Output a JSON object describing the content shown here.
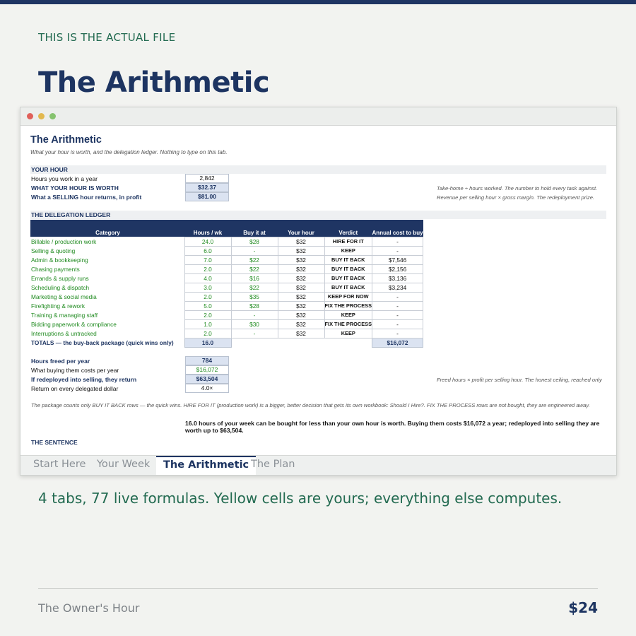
{
  "eyebrow": "THIS IS THE ACTUAL FILE",
  "headline": "The Arithmetic",
  "sheet": {
    "title": "The Arithmetic",
    "subtitle": "What your hour is worth, and the delegation ledger. Nothing to type on this tab.",
    "your_hour": {
      "section": "YOUR HOUR",
      "rows": [
        {
          "label": "Hours you work in a year",
          "value": "2,842",
          "note": ""
        },
        {
          "label": "WHAT YOUR HOUR IS WORTH",
          "value": "$32.37",
          "note": "Take-home ÷ hours worked. The number to hold every task against."
        },
        {
          "label": "What a SELLING hour returns, in profit",
          "value": "$81.00",
          "note": "Revenue per selling hour × gross margin. The redeployment prize."
        }
      ]
    },
    "ledger": {
      "section": "THE DELEGATION LEDGER",
      "headers": [
        "Category",
        "Hours / wk",
        "Buy it at",
        "Your hour",
        "Verdict",
        "Annual cost to buy"
      ],
      "rows": [
        [
          "Billable / production work",
          "24.0",
          "$28",
          "$32",
          "HIRE FOR IT",
          "-"
        ],
        [
          "Selling & quoting",
          "6.0",
          "-",
          "$32",
          "KEEP",
          "-"
        ],
        [
          "Admin & bookkeeping",
          "7.0",
          "$22",
          "$32",
          "BUY IT BACK",
          "$7,546"
        ],
        [
          "Chasing payments",
          "2.0",
          "$22",
          "$32",
          "BUY IT BACK",
          "$2,156"
        ],
        [
          "Errands & supply runs",
          "4.0",
          "$16",
          "$32",
          "BUY IT BACK",
          "$3,136"
        ],
        [
          "Scheduling & dispatch",
          "3.0",
          "$22",
          "$32",
          "BUY IT BACK",
          "$3,234"
        ],
        [
          "Marketing & social media",
          "2.0",
          "$35",
          "$32",
          "KEEP FOR NOW",
          "-"
        ],
        [
          "Firefighting & rework",
          "5.0",
          "$28",
          "$32",
          "FIX THE PROCESS",
          "-"
        ],
        [
          "Training & managing staff",
          "2.0",
          "-",
          "$32",
          "KEEP",
          "-"
        ],
        [
          "Bidding paperwork & compliance",
          "1.0",
          "$30",
          "$32",
          "FIX THE PROCESS",
          "-"
        ],
        [
          "Interruptions & untracked",
          "2.0",
          "-",
          "$32",
          "KEEP",
          "-"
        ]
      ],
      "totals": {
        "label": "TOTALS — the buy-back package (quick wins only)",
        "hours": "16.0",
        "annual": "$16,072"
      }
    },
    "summary": [
      {
        "label": "Hours freed per year",
        "value": "784",
        "note": ""
      },
      {
        "label": "What buying them costs per year",
        "value": "$16,072",
        "note": ""
      },
      {
        "label": "If redeployed into selling, they return",
        "value": "$63,504",
        "note": "Freed hours × profit per selling hour. The honest ceiling, reached only"
      },
      {
        "label": "Return on every delegated dollar",
        "value": "4.0×",
        "note": ""
      }
    ],
    "footnote": "The package counts only BUY IT BACK rows — the quick wins. HIRE FOR IT (production work) is a bigger, better decision that gets its own workbook: Should I Hire?. FIX THE PROCESS rows are not bought, they are engineered away.",
    "sentence": "16.0 hours of your week can be bought for less than your own hour is worth. Buying them costs $16,072 a year; redeployed into selling they are worth up to $63,504.",
    "sentence_section": "THE SENTENCE"
  },
  "tabs": [
    "Start Here",
    "Your Week",
    "The Arithmetic",
    "The Plan"
  ],
  "active_tab": "The Arithmetic",
  "caption": "4 tabs, 77 live formulas. Yellow cells are yours; everything else computes.",
  "brand": "The Owner's Hour",
  "price": "$24",
  "colors": {
    "navy": "#1f3563",
    "green_text": "#1f8a1f",
    "accent_green": "#226a50",
    "highlight": "#dbe3f1"
  }
}
